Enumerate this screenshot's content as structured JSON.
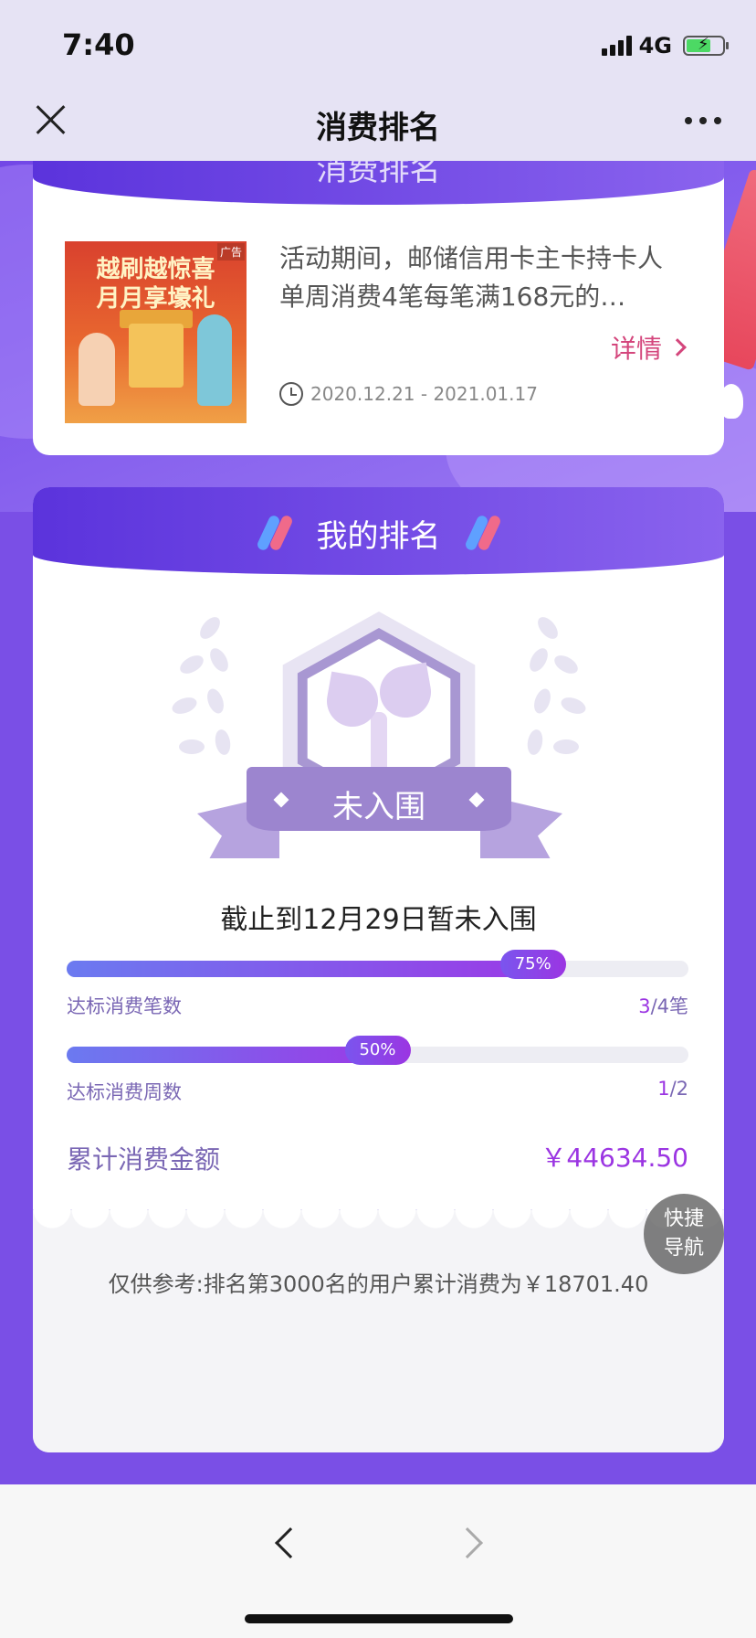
{
  "status": {
    "time": "7:40",
    "network": "4G"
  },
  "nav": {
    "title": "消费排名"
  },
  "activity": {
    "header_title": "消费排名",
    "ad_line1": "越刷越惊喜",
    "ad_line2": "月月享壕礼",
    "ad_badge": "广告",
    "description": "活动期间，邮储信用卡主卡持卡人单周消费4笔每笔满168元的…",
    "detail_label": "详情",
    "date_range": "2020.12.21 - 2021.01.17"
  },
  "ranking": {
    "title": "我的排名",
    "badge_label": "未入围",
    "deadline_text": "截止到12月29日暂未入围",
    "progress1": {
      "percent_label": "75%",
      "percent": 75,
      "label": "达标消费笔数",
      "current": "3",
      "total": "/4笔"
    },
    "progress2": {
      "percent_label": "50%",
      "percent": 50,
      "label": "达标消费周数",
      "current": "1",
      "total": "/2"
    },
    "total_label": "累计消费金额",
    "total_amount": "￥44634.50",
    "reference": "仅供参考:排名第3000名的用户累计消费为￥18701.40"
  },
  "quick_nav": {
    "line1": "快捷",
    "line2": "导航"
  },
  "colors": {
    "primary": "#7a4fe6",
    "accent": "#9b35e2",
    "link": "#d4467c"
  }
}
